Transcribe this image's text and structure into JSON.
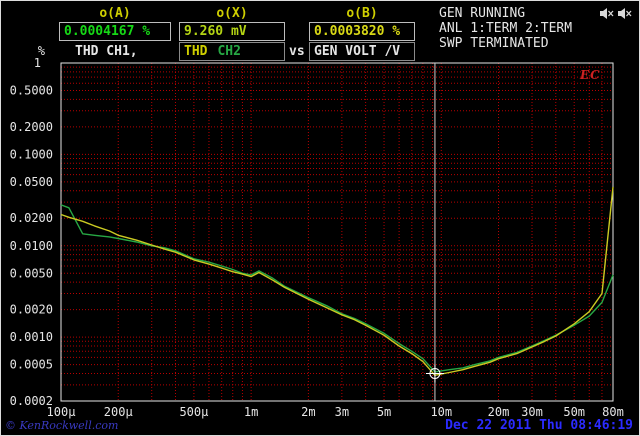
{
  "colors": {
    "label_yellow": "#cfcf00",
    "datetime_blue": "#2b2bff",
    "watermark_blue": "#3a3ac2"
  },
  "header": {
    "readouts": [
      {
        "label": "o(A)",
        "value": "0.0004167 %",
        "color": "#16d916"
      },
      {
        "label": "o(X)",
        "value": "9.260 mV",
        "color": "#b4d414"
      },
      {
        "label": "o(B)",
        "value": "0.0003820 %",
        "color": "#d9d916"
      }
    ],
    "trace_row": {
      "left": "THD  CH1,",
      "thd": "THD",
      "thd_color": "#cfcf00",
      "ch2": "CH2",
      "ch2_color": "#27a844",
      "vs": "vs",
      "right": "GEN VOLT /V"
    },
    "status": [
      "GEN RUNNING",
      "ANL 1:TERM 2:TERM",
      "SWP TERMINATED"
    ]
  },
  "logo": {
    "text": "EC"
  },
  "footer": {
    "watermark": "© KenRockwell.com",
    "datetime": "Dec 22 2011 Thu 08:46:19"
  },
  "chart_data": {
    "type": "line",
    "title": "THD CH1, THD CH2 vs GEN VOLT /V",
    "xlabel": "GEN VOLT /V",
    "ylabel": "%",
    "x_scale": "log",
    "y_scale": "log",
    "xlim": [
      0.0001,
      0.08
    ],
    "ylim": [
      0.0002,
      1
    ],
    "grid": "dotted red log-log minor grid",
    "legend_position": "none",
    "colors": {
      "grid": "#b80000",
      "frame": "#e6e6e6",
      "cursor": "#cfcfcf",
      "marker": "#ffffff"
    },
    "x_ticks": [
      {
        "v": 0.0001,
        "label": "100µ"
      },
      {
        "v": 0.0002,
        "label": "200µ"
      },
      {
        "v": 0.0005,
        "label": "500µ"
      },
      {
        "v": 0.001,
        "label": "1m"
      },
      {
        "v": 0.002,
        "label": "2m"
      },
      {
        "v": 0.003,
        "label": "3m"
      },
      {
        "v": 0.005,
        "label": "5m"
      },
      {
        "v": 0.01,
        "label": "10m"
      },
      {
        "v": 0.02,
        "label": "20m"
      },
      {
        "v": 0.03,
        "label": "30m"
      },
      {
        "v": 0.05,
        "label": "50m"
      },
      {
        "v": 0.08,
        "label": "80m"
      }
    ],
    "y_ticks": [
      {
        "v": 1,
        "label": "1"
      },
      {
        "v": 0.5,
        "label": "0.5000"
      },
      {
        "v": 0.2,
        "label": "0.2000"
      },
      {
        "v": 0.1,
        "label": "0.1000"
      },
      {
        "v": 0.05,
        "label": "0.0500"
      },
      {
        "v": 0.02,
        "label": "0.0200"
      },
      {
        "v": 0.01,
        "label": "0.0100"
      },
      {
        "v": 0.005,
        "label": "0.0050"
      },
      {
        "v": 0.002,
        "label": "0.0020"
      },
      {
        "v": 0.001,
        "label": "0.0010"
      },
      {
        "v": 0.0005,
        "label": "0.0005"
      },
      {
        "v": 0.0002,
        "label": "0.0002"
      }
    ],
    "cursor": {
      "x": 0.00926,
      "marker_y": 0.0004,
      "readout_a": 0.0004167,
      "readout_b": 0.000382
    },
    "series": [
      {
        "id": "ch1",
        "name": "THD CH1",
        "color": "#27a844",
        "x": [
          0.0001,
          0.00011,
          0.00013,
          0.00015,
          0.00018,
          0.0002,
          0.00025,
          0.0003,
          0.00035,
          0.0004,
          0.0005,
          0.0006,
          0.0007,
          0.0008,
          0.0009,
          0.001,
          0.0011,
          0.0013,
          0.0015,
          0.0018,
          0.002,
          0.0025,
          0.003,
          0.0035,
          0.004,
          0.005,
          0.006,
          0.007,
          0.008,
          0.00926,
          0.011,
          0.013,
          0.015,
          0.018,
          0.02,
          0.025,
          0.03,
          0.035,
          0.04,
          0.05,
          0.06,
          0.07,
          0.08
        ],
        "y": [
          0.028,
          0.026,
          0.0135,
          0.013,
          0.0125,
          0.012,
          0.011,
          0.01,
          0.0095,
          0.0088,
          0.0072,
          0.0066,
          0.006,
          0.0055,
          0.005,
          0.0048,
          0.0053,
          0.0044,
          0.0036,
          0.003,
          0.0027,
          0.0022,
          0.0018,
          0.0016,
          0.0014,
          0.0011,
          0.00085,
          0.0007,
          0.00058,
          0.0004167,
          0.00044,
          0.00046,
          0.0005,
          0.00055,
          0.0006,
          0.00068,
          0.0008,
          0.00092,
          0.00105,
          0.00135,
          0.0017,
          0.0024,
          0.0048
        ]
      },
      {
        "id": "ch2",
        "name": "THD CH2",
        "color": "#cbcb22",
        "x": [
          0.0001,
          0.00011,
          0.00013,
          0.00015,
          0.00018,
          0.0002,
          0.00025,
          0.0003,
          0.00035,
          0.0004,
          0.0005,
          0.0006,
          0.0007,
          0.0008,
          0.0009,
          0.001,
          0.0011,
          0.0013,
          0.0015,
          0.0018,
          0.002,
          0.0025,
          0.003,
          0.0035,
          0.004,
          0.005,
          0.006,
          0.007,
          0.008,
          0.00926,
          0.011,
          0.013,
          0.015,
          0.018,
          0.02,
          0.025,
          0.03,
          0.035,
          0.04,
          0.05,
          0.06,
          0.07,
          0.08
        ],
        "y": [
          0.022,
          0.0205,
          0.0185,
          0.0165,
          0.0145,
          0.013,
          0.0115,
          0.0102,
          0.0092,
          0.0085,
          0.007,
          0.0063,
          0.0057,
          0.0052,
          0.0049,
          0.0046,
          0.0051,
          0.0042,
          0.0035,
          0.0029,
          0.0026,
          0.0021,
          0.00175,
          0.00155,
          0.00135,
          0.00105,
          0.0008,
          0.00066,
          0.00054,
          0.000382,
          0.00041,
          0.00044,
          0.00048,
          0.00053,
          0.00058,
          0.00066,
          0.00078,
          0.0009,
          0.00103,
          0.0014,
          0.0019,
          0.003,
          0.044
        ]
      }
    ]
  }
}
